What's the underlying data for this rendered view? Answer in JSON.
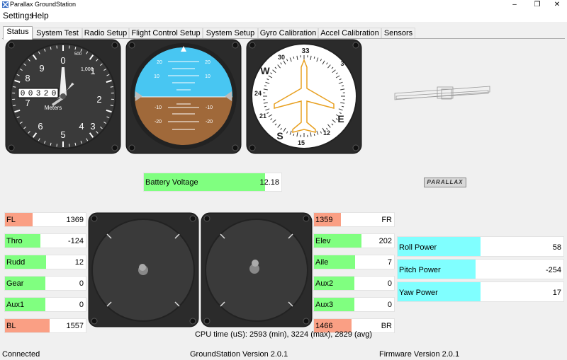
{
  "window": {
    "title": "Parallax GroundStation"
  },
  "menu": {
    "items": [
      "Settings",
      "Help"
    ]
  },
  "tabs": [
    "Status",
    "System Test",
    "Radio Setup",
    "Flight Control Setup",
    "System Setup",
    "Gyro Calibration",
    "Accel Calibration",
    "Sensors"
  ],
  "active_tab": "Status",
  "altimeter": {
    "dial_numbers": [
      "0",
      "1",
      "2",
      "3",
      "4",
      "5",
      "6",
      "7",
      "8",
      "9"
    ],
    "sub_labels": [
      "500",
      "1,000"
    ],
    "odometer_digits": [
      "0",
      "0",
      "3",
      "2",
      "0"
    ],
    "unit": "Meters"
  },
  "horizon": {
    "pitch_labels_sky": [
      "20",
      "10",
      "10",
      "20"
    ],
    "pitch_labels_ground": [
      "-10",
      "-10",
      "-20",
      "-20"
    ]
  },
  "heading_indicator": {
    "labels": [
      "33",
      "30",
      "W",
      "24",
      "21",
      "S",
      "15",
      "12",
      "E",
      "3"
    ]
  },
  "battery": {
    "label": "Battery Voltage",
    "value": "12.18",
    "level_fraction": 0.88
  },
  "logo": {
    "text": "PARALLAX"
  },
  "left_channels": [
    {
      "label": "FL",
      "value": "1369",
      "color": "#fa9f84",
      "fraction": 0.34
    },
    {
      "label": "Thro",
      "value": "-124",
      "color": "#80ff80",
      "fraction": 0.44
    },
    {
      "label": "Rudd",
      "value": "12",
      "color": "#80ff80",
      "fraction": 0.51
    },
    {
      "label": "Gear",
      "value": "0",
      "color": "#80ff80",
      "fraction": 0.5
    },
    {
      "label": "Aux1",
      "value": "0",
      "color": "#80ff80",
      "fraction": 0.5
    },
    {
      "label": "BL",
      "value": "1557",
      "color": "#fa9f84",
      "fraction": 0.55
    }
  ],
  "right_channels": [
    {
      "label": "1359",
      "value": "FR",
      "color": "#fa9f84",
      "fraction": 0.34
    },
    {
      "label": "Elev",
      "value": "202",
      "color": "#80ff80",
      "fraction": 0.59
    },
    {
      "label": "Aile",
      "value": "7",
      "color": "#80ff80",
      "fraction": 0.51
    },
    {
      "label": "Aux2",
      "value": "0",
      "color": "#80ff80",
      "fraction": 0.5
    },
    {
      "label": "Aux3",
      "value": "0",
      "color": "#80ff80",
      "fraction": 0.5
    },
    {
      "label": "1466",
      "value": "BR",
      "color": "#fa9f84",
      "fraction": 0.47
    }
  ],
  "power": [
    {
      "label": "Roll Power",
      "value": "58",
      "fraction": 0.5
    },
    {
      "label": "Pitch Power",
      "value": "-254",
      "fraction": 0.47
    },
    {
      "label": "Yaw Power",
      "value": "17",
      "fraction": 0.5
    }
  ],
  "cpu_time": "CPU time (uS): 2593 (min), 3224 (max), 2829 (avg)",
  "status": {
    "connection": "Connected",
    "gs_version": "GroundStation Version 2.0.1",
    "fw_version": "Firmware Version 2.0.1"
  },
  "colors": {
    "green": "#80ff80",
    "orange": "#fa9f84",
    "cyan": "#80ffff",
    "sky": "#48c6f2",
    "ground": "#a0693a",
    "heading_plane": "#e8a020"
  }
}
